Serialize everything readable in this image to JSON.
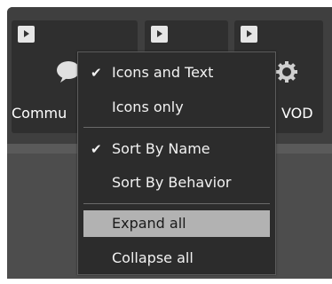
{
  "tiles": [
    {
      "label": "Commu",
      "icon": "chat-bubble-icon"
    },
    {
      "label": "",
      "icon": ""
    },
    {
      "label": "VOD",
      "icon": "gear-icon"
    }
  ],
  "menu": {
    "items": [
      {
        "label": "Icons and Text",
        "checked": "✔"
      },
      {
        "label": "Icons only",
        "checked": ""
      },
      {
        "label": "Sort By Name",
        "checked": "✔"
      },
      {
        "label": "Sort By Behavior",
        "checked": ""
      },
      {
        "label": "Expand all",
        "checked": "",
        "highlighted": true
      },
      {
        "label": "Collapse all",
        "checked": ""
      }
    ]
  },
  "colors": {
    "menu_bg": "#2c2c2c",
    "highlight": "#b2b2b2",
    "tile_bg": "#2f2f2f",
    "panel_bg": "#3f3f3f"
  }
}
